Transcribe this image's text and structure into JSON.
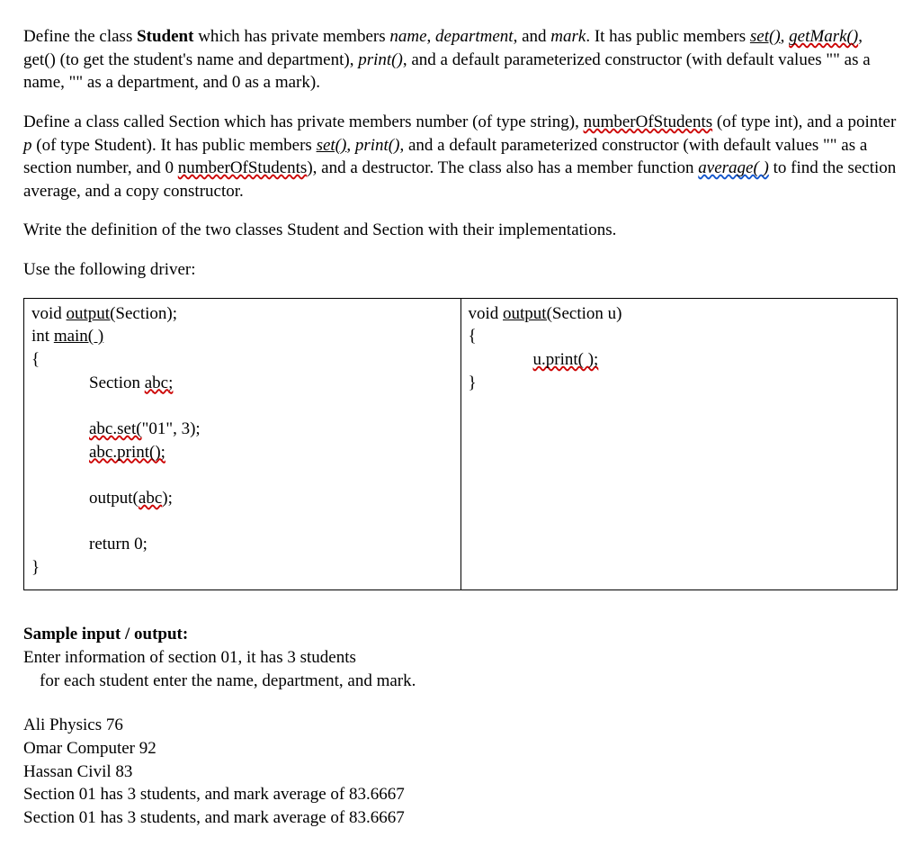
{
  "para1": {
    "t1": "Define the class ",
    "bold1": "Student",
    "t2": " which has private members ",
    "i1": "name",
    "t3": ", ",
    "i2": "department",
    "t4": ", and ",
    "i3": "mark",
    "t5": ". It has public members ",
    "u1": "set()",
    "t6": ", ",
    "u2": "getMark()",
    "t7": ", get() (to get the student's name and department), ",
    "i4": "print()",
    "t8": ", and a default parameterized constructor (with default values \"\" as a name, \"\" as a department, and 0 as a mark)."
  },
  "para2": {
    "t1": "Define a class called Section which has private members number (of type string), ",
    "w1": "numberOfStudents",
    "t2": " (of type int), and a pointer ",
    "i1": "p",
    "t3": " (of type Student). It has public members ",
    "u1": "set()",
    "t4": ", ",
    "i2": "print()",
    "t5": ", and a default parameterized constructor (with default values \"\" as a section number, and 0 ",
    "w2": "numberOfStudents",
    "t6": "), and a destructor. The class also has a member function ",
    "wb1": "average( )",
    "t7": " to find the section average, and a copy constructor."
  },
  "para3": "Write the definition of the two classes Student and Section with their implementations.",
  "para4": "Use the following driver:",
  "code": {
    "left": {
      "l1a": "void ",
      "l1u": "output(",
      "l1b": "Section);",
      "l2a": "int ",
      "l2u": "main( )",
      "l3": "{",
      "l4a": "Section ",
      "l4w": "abc;",
      "l5w": "abc.set(",
      "l5b": "\"01\", 3);",
      "l6w": "abc.print();",
      "l7a": "output(",
      "l7w": "abc",
      "l7c": ");",
      "l8": "return 0;",
      "l9": "}"
    },
    "right": {
      "l1a": "void ",
      "l1u": "output(",
      "l1b": "Section u)",
      "l2": "{",
      "l3w": "u.print( );",
      "l4": "}"
    }
  },
  "sample": {
    "heading": "Sample input / output:",
    "l1": "Enter information of section 01, it has 3 students",
    "l2": "for each student enter the name, department, and mark.",
    "l3": "Ali Physics 76",
    "l4": "Omar Computer 92",
    "l5": "Hassan Civil 83",
    "l6": "Section 01 has 3 students, and mark average of 83.6667",
    "l7": "Section 01 has 3 students, and mark average of 83.6667"
  }
}
